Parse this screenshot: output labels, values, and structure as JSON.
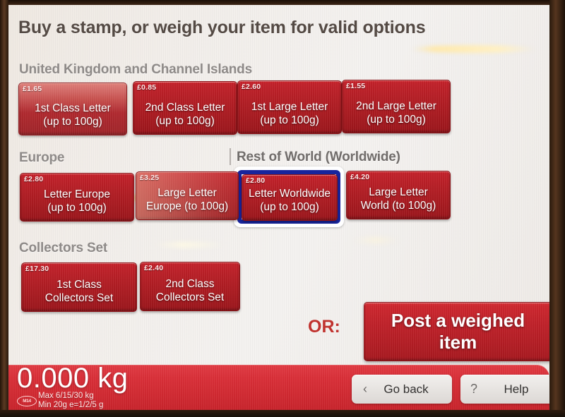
{
  "screen": {
    "title": "Buy a stamp, or weigh your item for valid options"
  },
  "sections": {
    "uk": {
      "heading": "United Kingdom and Channel Islands"
    },
    "europe": {
      "heading": "Europe"
    },
    "rest_of_world": {
      "heading": "Rest of World (Worldwide)"
    },
    "collectors": {
      "heading": "Collectors Set"
    }
  },
  "stamps": {
    "uk": [
      {
        "price": "£1.65",
        "line1": "1st Class Letter",
        "line2": "(up to 100g)"
      },
      {
        "price": "£0.85",
        "line1": "2nd Class Letter",
        "line2": "(up to 100g)"
      },
      {
        "price": "£2.60",
        "line1": "1st Large Letter",
        "line2": "(up to 100g)"
      },
      {
        "price": "£1.55",
        "line1": "2nd Large Letter",
        "line2": "(up to 100g)"
      }
    ],
    "europe": [
      {
        "price": "£2.80",
        "line1": "Letter Europe",
        "line2": "(up to 100g)"
      },
      {
        "price": "£3.25",
        "line1": "Large Letter",
        "line2": "Europe (to 100g)"
      }
    ],
    "rest_of_world": [
      {
        "price": "£2.80",
        "line1": "Letter Worldwide",
        "line2": "(up to 100g)",
        "selected": true
      },
      {
        "price": "£4.20",
        "line1": "Large Letter",
        "line2": "World (to 100g)"
      }
    ],
    "collectors": [
      {
        "price": "£17.30",
        "line1": "1st Class",
        "line2": "Collectors Set"
      },
      {
        "price": "£2.40",
        "line1": "2nd Class",
        "line2": "Collectors Set"
      }
    ]
  },
  "weigh": {
    "or_label": "OR:",
    "post_weighed_line1": "Post a weighed",
    "post_weighed_line2": "item"
  },
  "status_bar": {
    "weight": "0.000 kg",
    "spec_line1": "Max 6/15/30 kg",
    "spec_line2": "Min 20g  e=1/2/5 g",
    "badge_text": "M14"
  },
  "nav": {
    "go_back": {
      "label": "Go back",
      "icon": "‹"
    },
    "help": {
      "label": "Help",
      "icon": "?"
    }
  },
  "colors": {
    "stamp_red": "#b81f26",
    "bar_red": "#d12931",
    "selection_blue": "#18249c",
    "heading_gray": "#8e8a88",
    "title_gray": "#544a44",
    "or_red": "#c0332f"
  }
}
